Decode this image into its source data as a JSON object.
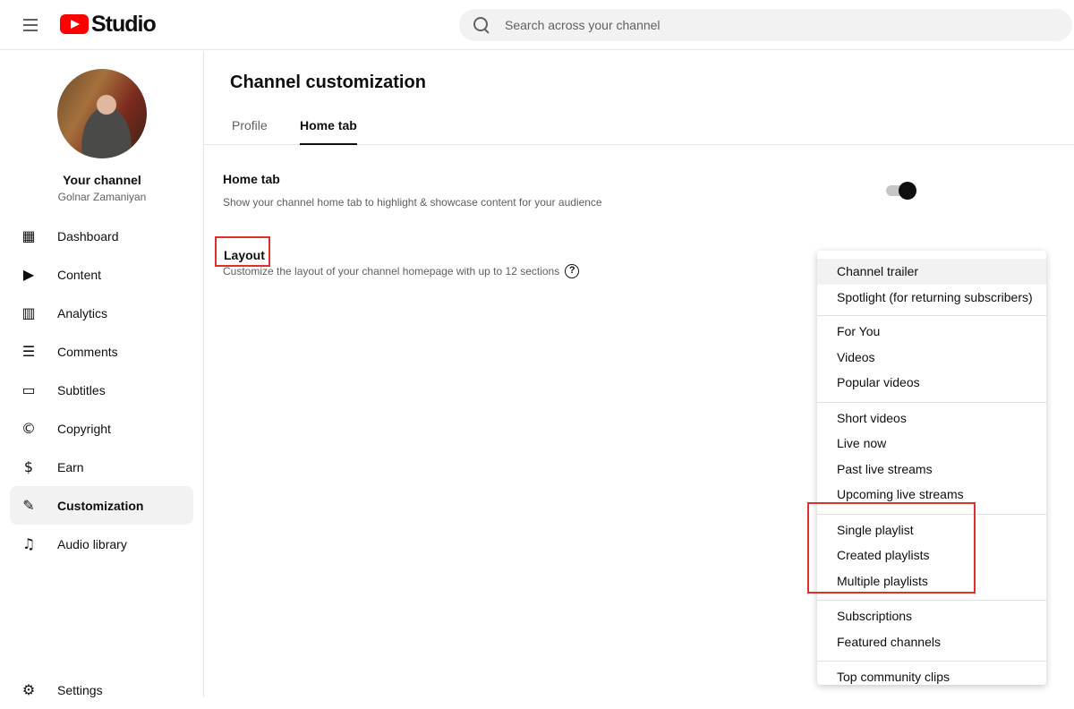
{
  "app": {
    "title": "Studio",
    "accent": "#ff0000"
  },
  "search": {
    "placeholder": "Search across your channel"
  },
  "channel": {
    "label": "Your channel",
    "handle": "Golnar Zamaniyan"
  },
  "sidebar": {
    "items": [
      {
        "label": "Dashboard",
        "icon": "dashboard-icon",
        "glyph": "▦"
      },
      {
        "label": "Content",
        "icon": "content-icon",
        "glyph": "▶"
      },
      {
        "label": "Analytics",
        "icon": "analytics-icon",
        "glyph": "▥"
      },
      {
        "label": "Comments",
        "icon": "comments-icon",
        "glyph": "☰"
      },
      {
        "label": "Subtitles",
        "icon": "subtitles-icon",
        "glyph": "▭"
      },
      {
        "label": "Copyright",
        "icon": "copyright-icon",
        "glyph": "©"
      },
      {
        "label": "Earn",
        "icon": "dollar-icon",
        "glyph": "$"
      },
      {
        "label": "Customization",
        "icon": "magic-wand-icon",
        "glyph": "✎"
      },
      {
        "label": "Audio library",
        "icon": "music-icon",
        "glyph": "♫"
      }
    ],
    "active_index": 7,
    "settings": {
      "label": "Settings",
      "glyph": "⚙"
    }
  },
  "main": {
    "title": "Channel customization",
    "tabs": [
      {
        "label": "Profile"
      },
      {
        "label": "Home tab"
      }
    ],
    "active_tab": "Home tab",
    "home_tab": {
      "title": "Home tab",
      "description": "Show your channel home tab to highlight & showcase content for your audience",
      "toggle_on": true
    },
    "layout": {
      "title": "Layout",
      "description": "Customize the layout of your channel homepage with up to 12 sections",
      "help": "?"
    }
  },
  "menu": {
    "groups": [
      [
        "Channel trailer",
        "Spotlight (for returning subscribers)"
      ],
      [
        "For You",
        "Videos",
        "Popular videos"
      ],
      [
        "Short videos",
        "Live now",
        "Past live streams",
        "Upcoming live streams"
      ],
      [
        "Single playlist",
        "Created playlists",
        "Multiple playlists"
      ],
      [
        "Subscriptions",
        "Featured channels"
      ],
      [
        "Top community clips"
      ]
    ]
  }
}
